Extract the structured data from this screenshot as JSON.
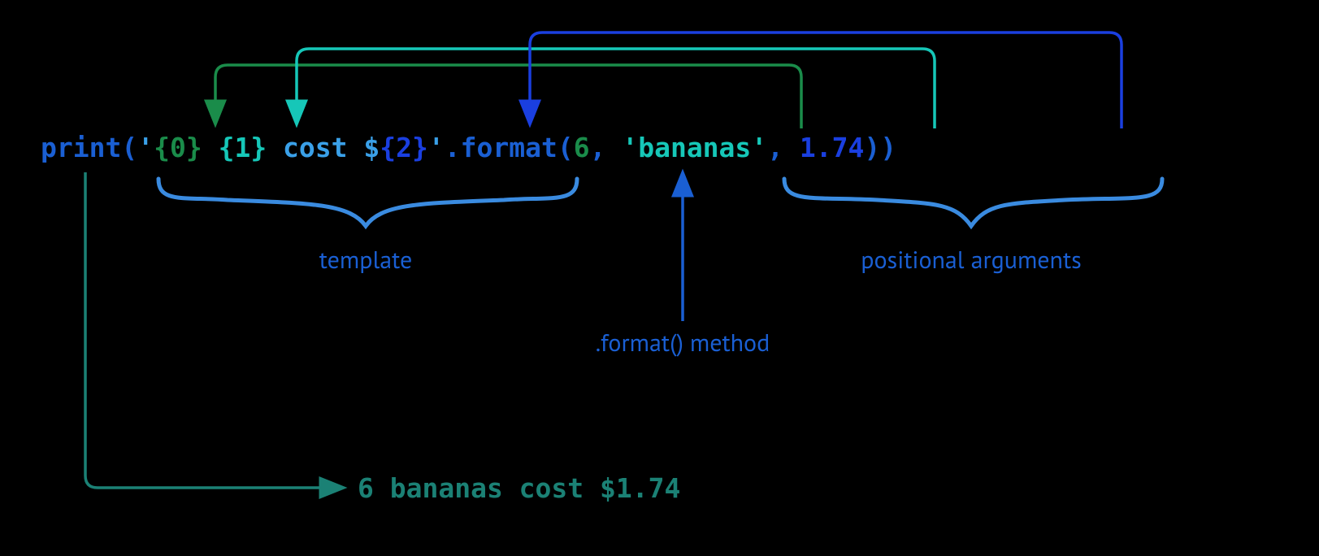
{
  "code_tokens": {
    "print": {
      "text": "print",
      "fill": "#1a5fd3"
    },
    "lparen": {
      "text": "(",
      "fill": "#1a5fd3"
    },
    "q1": {
      "text": "'",
      "fill": "#3aa0e8"
    },
    "brace0": {
      "text": "{0}",
      "fill": "#1a8c4a"
    },
    "sp1": {
      "text": " ",
      "fill": "#3aa0e8"
    },
    "brace1": {
      "text": "{1}",
      "fill": "#16c7b8"
    },
    "mid": {
      "text": " cost $",
      "fill": "#3aa0e8"
    },
    "brace2": {
      "text": "{2}",
      "fill": "#1a3fe0"
    },
    "q2": {
      "text": "'",
      "fill": "#3aa0e8"
    },
    "dot": {
      "text": ".",
      "fill": "#1a5fd3"
    },
    "format": {
      "text": "format",
      "fill": "#1a5fd3"
    },
    "lparen2": {
      "text": "(",
      "fill": "#1a5fd3"
    },
    "arg0": {
      "text": "6",
      "fill": "#1a8c4a"
    },
    "comma1": {
      "text": ", ",
      "fill": "#1a5fd3"
    },
    "arg1": {
      "text": "'bananas'",
      "fill": "#16c7b8"
    },
    "comma2": {
      "text": ", ",
      "fill": "#1a5fd3"
    },
    "arg2": {
      "text": "1.74",
      "fill": "#1a3fe0"
    },
    "rparen2": {
      "text": ")",
      "fill": "#1a5fd3"
    },
    "rparen": {
      "text": ")",
      "fill": "#1a5fd3"
    }
  },
  "labels": {
    "template": "template",
    "args": "positional arguments",
    "method": ".format() method"
  },
  "output": "6 bananas cost $1.74",
  "colors": {
    "green": "#1a8c4a",
    "teal": "#16c7b8",
    "blue": "#1a3fe0",
    "bracket": "#3a8be0",
    "output_arrow": "#1b8175",
    "label_blue": "#1a5fd3"
  }
}
